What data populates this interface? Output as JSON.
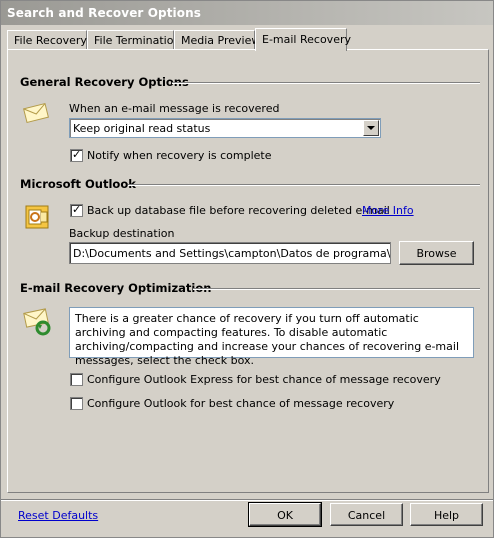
{
  "window": {
    "title": "Search and Recover Options"
  },
  "tabs": [
    {
      "label": "File Recovery"
    },
    {
      "label": "File Termination"
    },
    {
      "label": "Media Preview"
    },
    {
      "label": "E-mail Recovery",
      "active": true
    }
  ],
  "general": {
    "title": "General Recovery Options",
    "when_label": "When an e-mail message is recovered",
    "read_status_select": "Keep original read status",
    "notify_label": "Notify when recovery is complete",
    "notify_checked": true
  },
  "outlook": {
    "title": "Microsoft Outlook",
    "backup_label": "Back up database file before recovering deleted e-mail",
    "backup_checked": true,
    "more_info": "More Info",
    "destination_label": "Backup destination",
    "destination_value": "D:\\Documents and Settings\\campton\\Datos de programa\\iolo\\Sear",
    "browse_label": "Browse"
  },
  "optimization": {
    "title": "E-mail Recovery Optimization",
    "info_text": "There is a greater chance of recovery if you turn off automatic archiving and compacting features. To disable automatic archiving/compacting and increase your chances of recovering e-mail messages, select the check box.",
    "express_label": "Configure Outlook Express for best chance of message recovery",
    "express_checked": false,
    "outlook_label": "Configure Outlook for best chance of message recovery",
    "outlook_checked": false
  },
  "footer": {
    "reset_label": "Reset Defaults",
    "ok_label": "OK",
    "cancel_label": "Cancel",
    "help_label": "Help"
  },
  "icons": {
    "envelope": "envelope-icon",
    "outlook": "outlook-icon",
    "envelope_recover": "envelope-recover-icon",
    "checkmark": "✓"
  }
}
